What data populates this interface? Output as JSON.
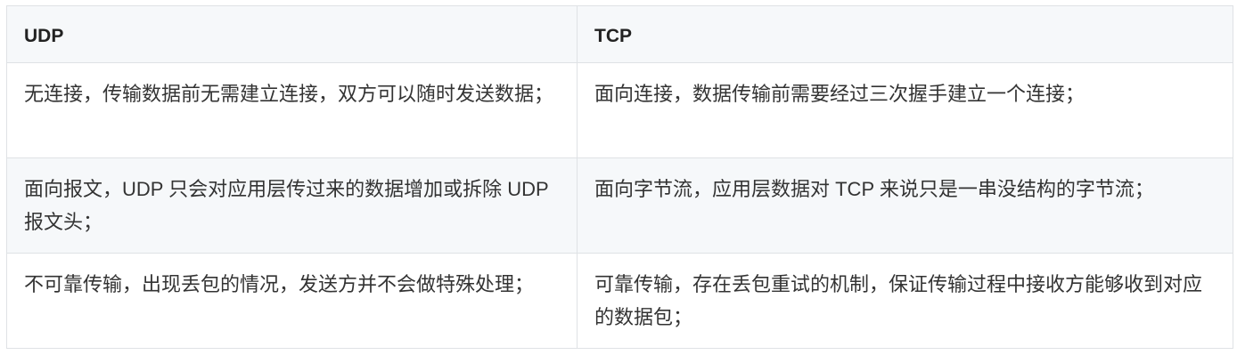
{
  "table": {
    "headers": [
      "UDP",
      "TCP"
    ],
    "rows": [
      [
        "无连接，传输数据前无需建立连接，双方可以随时发送数据；",
        "面向连接，数据传输前需要经过三次握手建立一个连接；"
      ],
      [
        "面向报文，UDP 只会对应用层传过来的数据增加或拆除 UDP 报文头；",
        "面向字节流，应用层数据对 TCP 来说只是一串没结构的字节流；"
      ],
      [
        "不可靠传输，出现丢包的情况，发送方并不会做特殊处理；",
        "可靠传输，存在丢包重试的机制，保证传输过程中接收方能够收到对应的数据包；"
      ]
    ]
  }
}
